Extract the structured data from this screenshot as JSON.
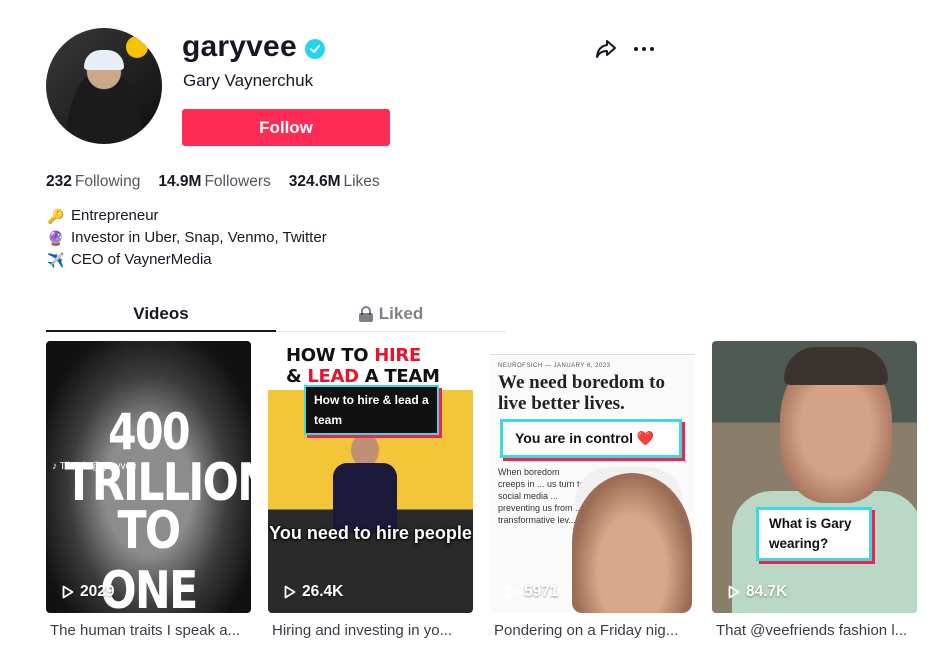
{
  "profile": {
    "username": "garyvee",
    "nickname": "Gary Vaynerchuk",
    "verified": true,
    "follow_label": "Follow",
    "accent_color": "#fe2c55"
  },
  "stats": {
    "following_count": "232",
    "following_label": "Following",
    "followers_count": "14.9M",
    "followers_label": "Followers",
    "likes_count": "324.6M",
    "likes_label": "Likes"
  },
  "bio": [
    {
      "icon": "key-icon",
      "emoji": "🔑",
      "text": "Entrepreneur"
    },
    {
      "icon": "crystal-ball-icon",
      "emoji": "🔮",
      "text": "Investor in Uber, Snap, Venmo, Twitter"
    },
    {
      "icon": "airplane-icon",
      "emoji": "✈️",
      "text": "CEO of VaynerMedia"
    }
  ],
  "tabs": [
    {
      "label": "Videos",
      "active": true
    },
    {
      "label": "Liked",
      "active": false,
      "locked": true
    }
  ],
  "videos": [
    {
      "views": "2029",
      "caption": "The human traits I speak a...",
      "overlay_lines": [
        "400",
        "TRILLION",
        "TO ONE"
      ],
      "watermark": "♪ TikTok @garyvee"
    },
    {
      "views": "26.4K",
      "caption": "Hiring and investing in yo...",
      "headline_part1": "HOW TO ",
      "headline_red1": "HIRE",
      "headline_part2": "& ",
      "headline_red2": "LEAD",
      "headline_part3": " A TEAM",
      "badge": "How to hire & lead a team",
      "subtitle": "You need to hire people"
    },
    {
      "views": "5971",
      "caption": "Pondering on a Friday nig...",
      "meta": "NEUROFSICH — JANUARY 6, 2023",
      "headline": "We need boredom to live better lives.",
      "badge": "You are in control ❤️",
      "body": "When boredom creeps in ... us turn to social media ... preventing us from ... transformative lev..."
    },
    {
      "views": "84.7K",
      "caption": "That @veefriends fashion l...",
      "badge": "What is Gary wearing?"
    }
  ]
}
